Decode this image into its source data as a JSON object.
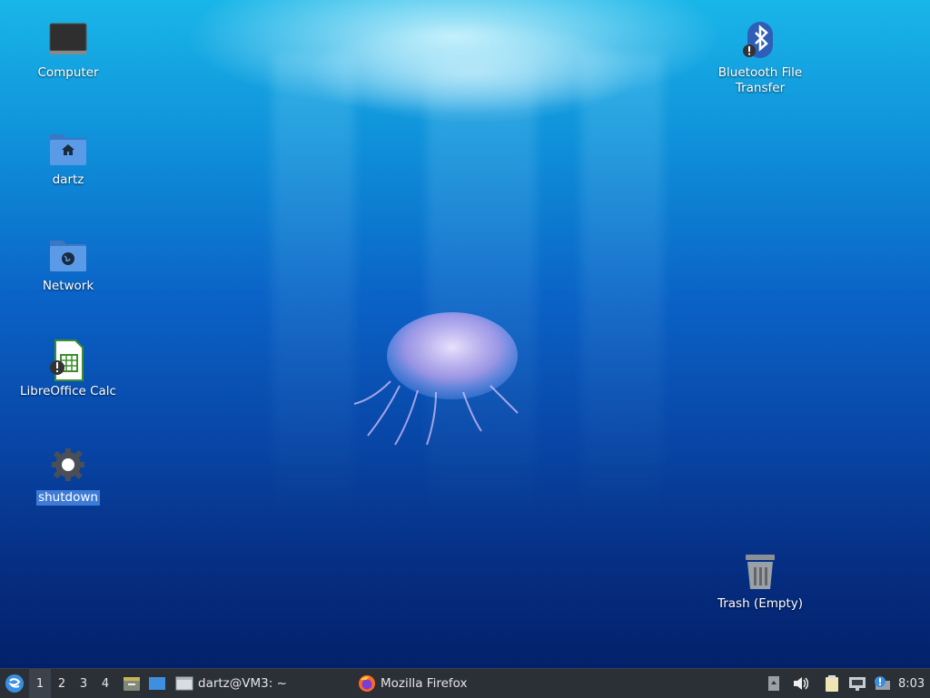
{
  "desktop": {
    "icons": [
      {
        "name": "computer",
        "label": "Computer",
        "selected": false
      },
      {
        "name": "home-folder",
        "label": "dartz",
        "selected": false
      },
      {
        "name": "network",
        "label": "Network",
        "selected": false
      },
      {
        "name": "libreoffice-calc",
        "label": "LibreOffice Calc",
        "selected": false
      },
      {
        "name": "shutdown",
        "label": "shutdown",
        "selected": true
      },
      {
        "name": "bluetooth-file-transfer",
        "label_line1": "Bluetooth File",
        "label_line2": "Transfer",
        "selected": false
      },
      {
        "name": "trash",
        "label": "Trash (Empty)",
        "selected": false
      }
    ]
  },
  "panel": {
    "workspaces": [
      "1",
      "2",
      "3",
      "4"
    ],
    "active_workspace": "1",
    "tasks": [
      {
        "label": "dartz@VM3: ~",
        "icon": "terminal-icon"
      },
      {
        "label": "Mozilla Firefox",
        "icon": "firefox-icon"
      }
    ],
    "clock": "8:03"
  },
  "colors": {
    "panel_bg": "#2b2f36",
    "selection": "#3d7bd6",
    "folder_blue": "#4a8fd9"
  }
}
